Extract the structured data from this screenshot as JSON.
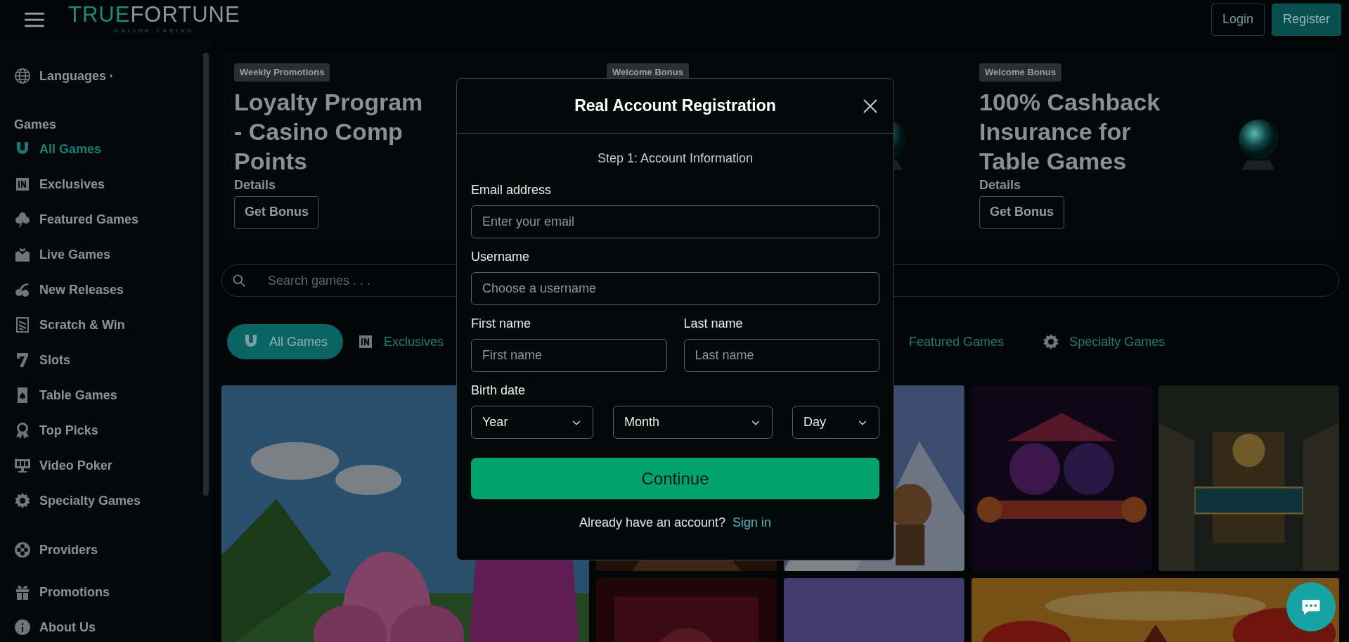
{
  "header": {
    "logo": {
      "accent": "TRUE",
      "rest": "FORTUNE",
      "tagline": "ONLINE CASINO"
    },
    "buttons": [
      {
        "label": "Login",
        "kind": "outline"
      },
      {
        "label": "Register",
        "kind": "filled"
      }
    ]
  },
  "sidebar": {
    "languages": "Languages",
    "heading": "Games",
    "items": [
      {
        "label": "All Games",
        "selected": true
      },
      {
        "label": "Exclusives",
        "selected": false
      },
      {
        "label": "Featured Games",
        "selected": false
      },
      {
        "label": "Live Games",
        "selected": false
      },
      {
        "label": "New Releases",
        "selected": false
      },
      {
        "label": "Scratch & Win",
        "selected": false
      },
      {
        "label": "Slots",
        "selected": false
      },
      {
        "label": "Table Games",
        "selected": false
      },
      {
        "label": "Top Picks",
        "selected": false
      },
      {
        "label": "Video Poker",
        "selected": false
      },
      {
        "label": "Specialty Games",
        "selected": false
      }
    ],
    "extra_items": [
      {
        "label": "Providers",
        "selected": false
      },
      {
        "label": "Promotions",
        "selected": false
      },
      {
        "label": "About Us",
        "selected": false
      }
    ]
  },
  "promos": [
    {
      "badge": "Weekly Promotions",
      "title": "Loyalty Program - Casino Comp Points",
      "details": "Details",
      "button": "Get Bonus"
    },
    {
      "badge": "Welcome Bonus"
    },
    {
      "badge": "Welcome Bonus",
      "title": "100% Cashback Insurance for Table Games",
      "details": "Details",
      "button": "Get Bonus"
    }
  ],
  "search": {
    "placeholder": "Search games . . ."
  },
  "category_tabs": [
    {
      "label": "All Games",
      "selected": true
    },
    {
      "label": "Exclusives",
      "selected": false
    },
    {
      "label": "Featured Games",
      "selected": false
    },
    {
      "label": "Specialty Games",
      "selected": false
    }
  ],
  "modal": {
    "title": "Real Account Registration",
    "step": "Step 1: Account Information",
    "fields": [
      {
        "label": "Email address",
        "placeholder": "Enter your email"
      },
      {
        "label": "Username",
        "placeholder": "Choose a username"
      }
    ],
    "name_fields": [
      {
        "label": "First name",
        "placeholder": "First name"
      },
      {
        "label": "Last name",
        "placeholder": "Last name"
      }
    ],
    "birth_date": {
      "label": "Birth date",
      "selects": [
        "Year",
        "Month",
        "Day"
      ]
    },
    "submit": "Continue",
    "footer_text": "Already have an account?",
    "footer_link": "Sign in"
  }
}
